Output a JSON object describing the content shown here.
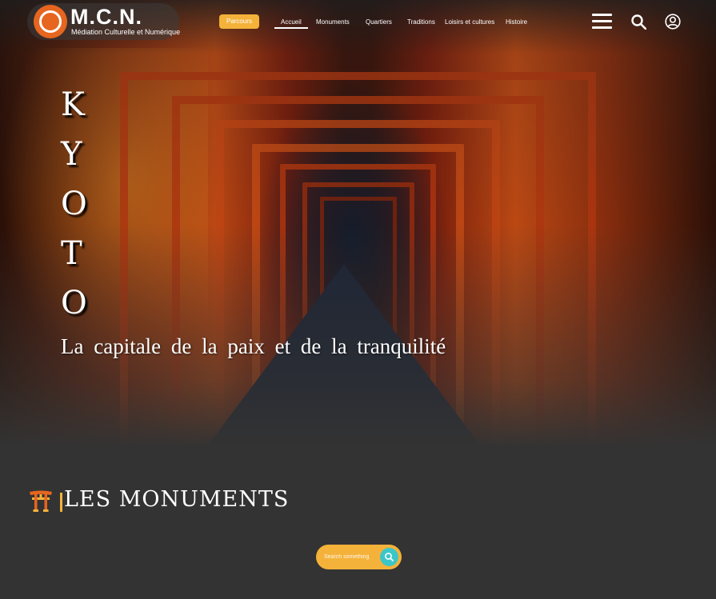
{
  "brand": {
    "title": "M.C.N.",
    "subtitle": "Médiation Culturelle et Numérique"
  },
  "nav": {
    "parcours_label": "Parcours",
    "links": [
      "Accueil",
      "Monuments",
      "Quartiers",
      "Traditions",
      "Loisirs et cultures",
      "Histoire"
    ],
    "active": "Accueil"
  },
  "icons": {
    "menu": "hamburger-menu-icon",
    "search": "search-icon",
    "account": "user-account-icon",
    "section": "torii-gate-icon",
    "search_go": "search-icon"
  },
  "hero": {
    "letters": [
      "K",
      "Y",
      "O",
      "T",
      "O"
    ],
    "tagline": "La capitale de la paix et de la tranquilité"
  },
  "section": {
    "title": "LES MONUMENTS"
  },
  "search": {
    "placeholder": "Search something"
  },
  "colors": {
    "accent": "#f4b23a",
    "search_button": "#3cc6c9",
    "logo": "#e6651f",
    "background": "#333333"
  }
}
